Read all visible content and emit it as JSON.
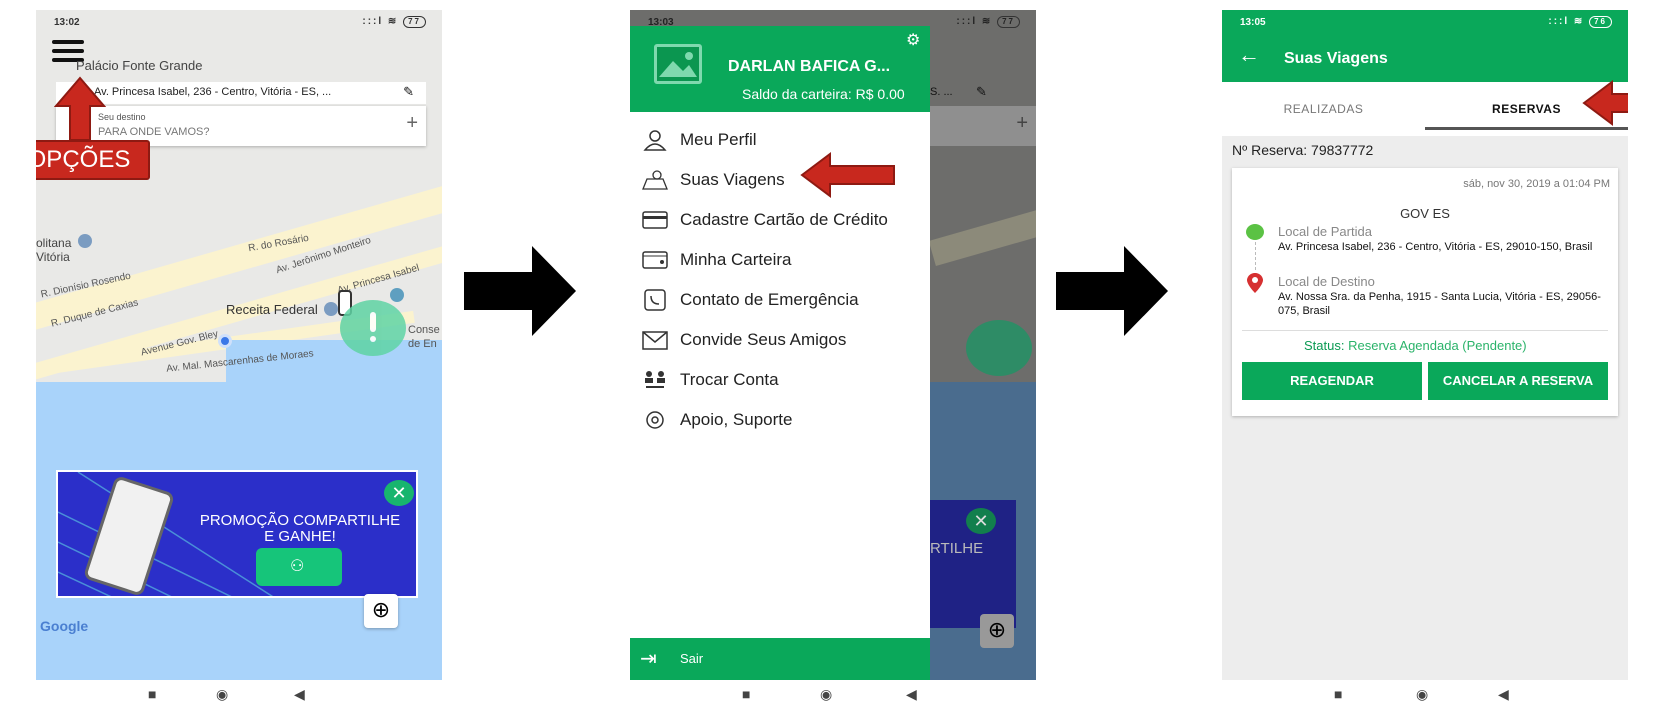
{
  "phone1": {
    "status_time": "13:02",
    "status_icons": ":::l ≋",
    "battery": "77",
    "place_name": "Palácio Fonte Grande",
    "origin_address": "Av. Princesa Isabel, 236 - Centro, Vitória - ES, ...",
    "dest_label": "Seu destino",
    "dest_placeholder": "PARA ONDE VAMOS?",
    "options_label": "OPÇÕES",
    "map_labels": {
      "politana": "olitana",
      "vitoria": "Vitória",
      "rosario": "R. do Rosário",
      "jeronimo": "Av. Jerônimo Monteiro",
      "princesa": "Av. Princesa Isabel",
      "dionisio": "R. Dionísio Rosendo",
      "duque": "R. Duque de Caxias",
      "receita": "Receita Federal",
      "bley": "Avenue Gov. Bley",
      "mascarenhas": "Av. Mal. Mascarenhas de Moraes",
      "conse": "Conse",
      "de_en": "de En"
    },
    "banner_line1": "PROMOÇÃO COMPARTILHE",
    "banner_line2": "E GANHE!",
    "google": "Google"
  },
  "phone2": {
    "status_time": "13:03",
    "battery": "77",
    "user_name": "DARLAN BAFICA G...",
    "wallet": "Saldo da carteira: R$ 0.00",
    "menu": [
      {
        "label": "Meu Perfil",
        "icon": "user-icon"
      },
      {
        "label": "Suas Viagens",
        "icon": "trip-map-icon"
      },
      {
        "label": "Cadastre Cartão de Crédito",
        "icon": "credit-card-icon"
      },
      {
        "label": "Minha Carteira",
        "icon": "wallet-icon"
      },
      {
        "label": "Contato de Emergência",
        "icon": "emergency-contact-icon"
      },
      {
        "label": "Convide Seus Amigos",
        "icon": "envelope-icon"
      },
      {
        "label": "Trocar Conta",
        "icon": "switch-account-icon"
      },
      {
        "label": "Apoio, Suporte",
        "icon": "support-icon"
      }
    ],
    "logout": "Sair",
    "bg_text": "RTILHE",
    "bg_fragment_s": "S. ..."
  },
  "phone3": {
    "status_time": "13:05",
    "battery": "76",
    "title": "Suas Viagens",
    "tabs": [
      "REALIZADAS",
      "RESERVAS"
    ],
    "reserve_label": "Nº Reserva:",
    "reserve_number": "79837772",
    "date": "sáb, nov 30, 2019 a 01:04 PM",
    "company": "GOV ES",
    "origin_label": "Local de Partida",
    "origin_address": "Av. Princesa Isabel, 236 - Centro, Vitória - ES, 29010-150, Brasil",
    "dest_label": "Local de Destino",
    "dest_address": "Av. Nossa Sra. da Penha, 1915 - Santa Lucia, Vitória - ES, 29056-075, Brasil",
    "status_label": "Status:",
    "status_value": "Reserva Agendada (Pendente)",
    "btn_reschedule": "REAGENDAR",
    "btn_cancel": "CANCELAR A RESERVA"
  },
  "colors": {
    "green": "#0aa85a",
    "red_arrow": "#c8281e",
    "banner_blue": "#2b2fc9",
    "water": "#a9d3fa"
  }
}
